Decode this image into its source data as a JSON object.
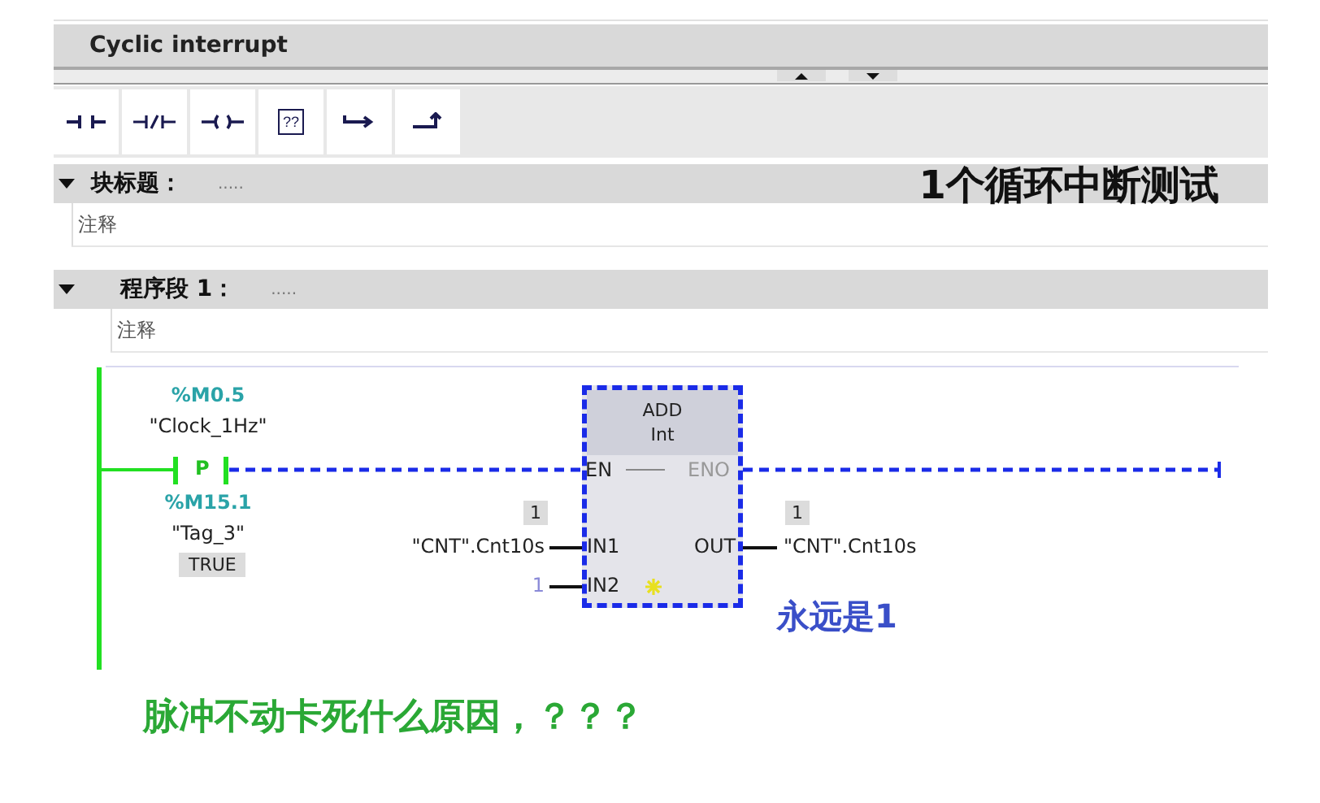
{
  "editor": {
    "title": "Cyclic interrupt"
  },
  "toolbar": [
    {
      "kind": "contact"
    },
    {
      "kind": "nc-contact"
    },
    {
      "kind": "coil"
    },
    {
      "kind": "box",
      "label": "??"
    },
    {
      "kind": "branch-open"
    },
    {
      "kind": "branch-close"
    }
  ],
  "block": {
    "expanded": true,
    "label": "块标题：",
    "title": ".....",
    "comment": "注释"
  },
  "annotation_top": "1个循环中断测试",
  "network": {
    "expanded": true,
    "label": "程序段 1：",
    "title": ".....",
    "comment": "注释"
  },
  "contact": {
    "address": "%M0.5",
    "tag": "\"Clock_1Hz\"",
    "symbol": "P",
    "edge_address": "%M15.1",
    "edge_tag": "\"Tag_3\"",
    "edge_value": "TRUE"
  },
  "box": {
    "name": "ADD",
    "type": "Int",
    "selected": true,
    "en": "EN",
    "eno": "ENO",
    "in1": "IN1",
    "in1_value": "1",
    "in1_operand": "\"CNT\".Cnt10s",
    "in2": "IN2",
    "in2_operand": "1",
    "out": "OUT",
    "out_value": "1",
    "out_operand": "\"CNT\".Cnt10s"
  },
  "annotation_note": "永远是1",
  "question": "脉冲不动卡死什么原因，？？？"
}
